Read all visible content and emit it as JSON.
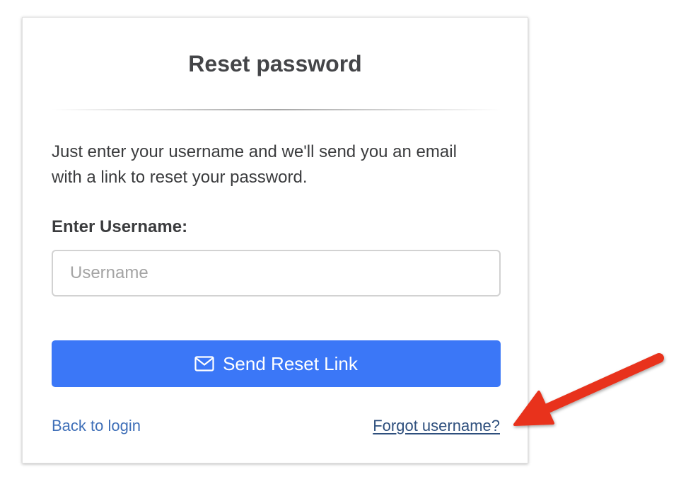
{
  "card": {
    "title": "Reset password",
    "description": "Just enter your username and we'll send you an email with a link to reset your password.",
    "username_label": "Enter Username:",
    "username_placeholder": "Username",
    "username_value": "",
    "send_button_label": "Send Reset Link",
    "send_button_icon": "envelope-icon",
    "back_link_label": "Back to login",
    "forgot_link_label": "Forgot username?"
  },
  "annotation": {
    "arrow_icon": "red-arrow-icon",
    "arrow_color": "#e8321c"
  },
  "colors": {
    "primary_button": "#3b77f7",
    "link": "#3f6fb8",
    "title_text": "#444548"
  }
}
